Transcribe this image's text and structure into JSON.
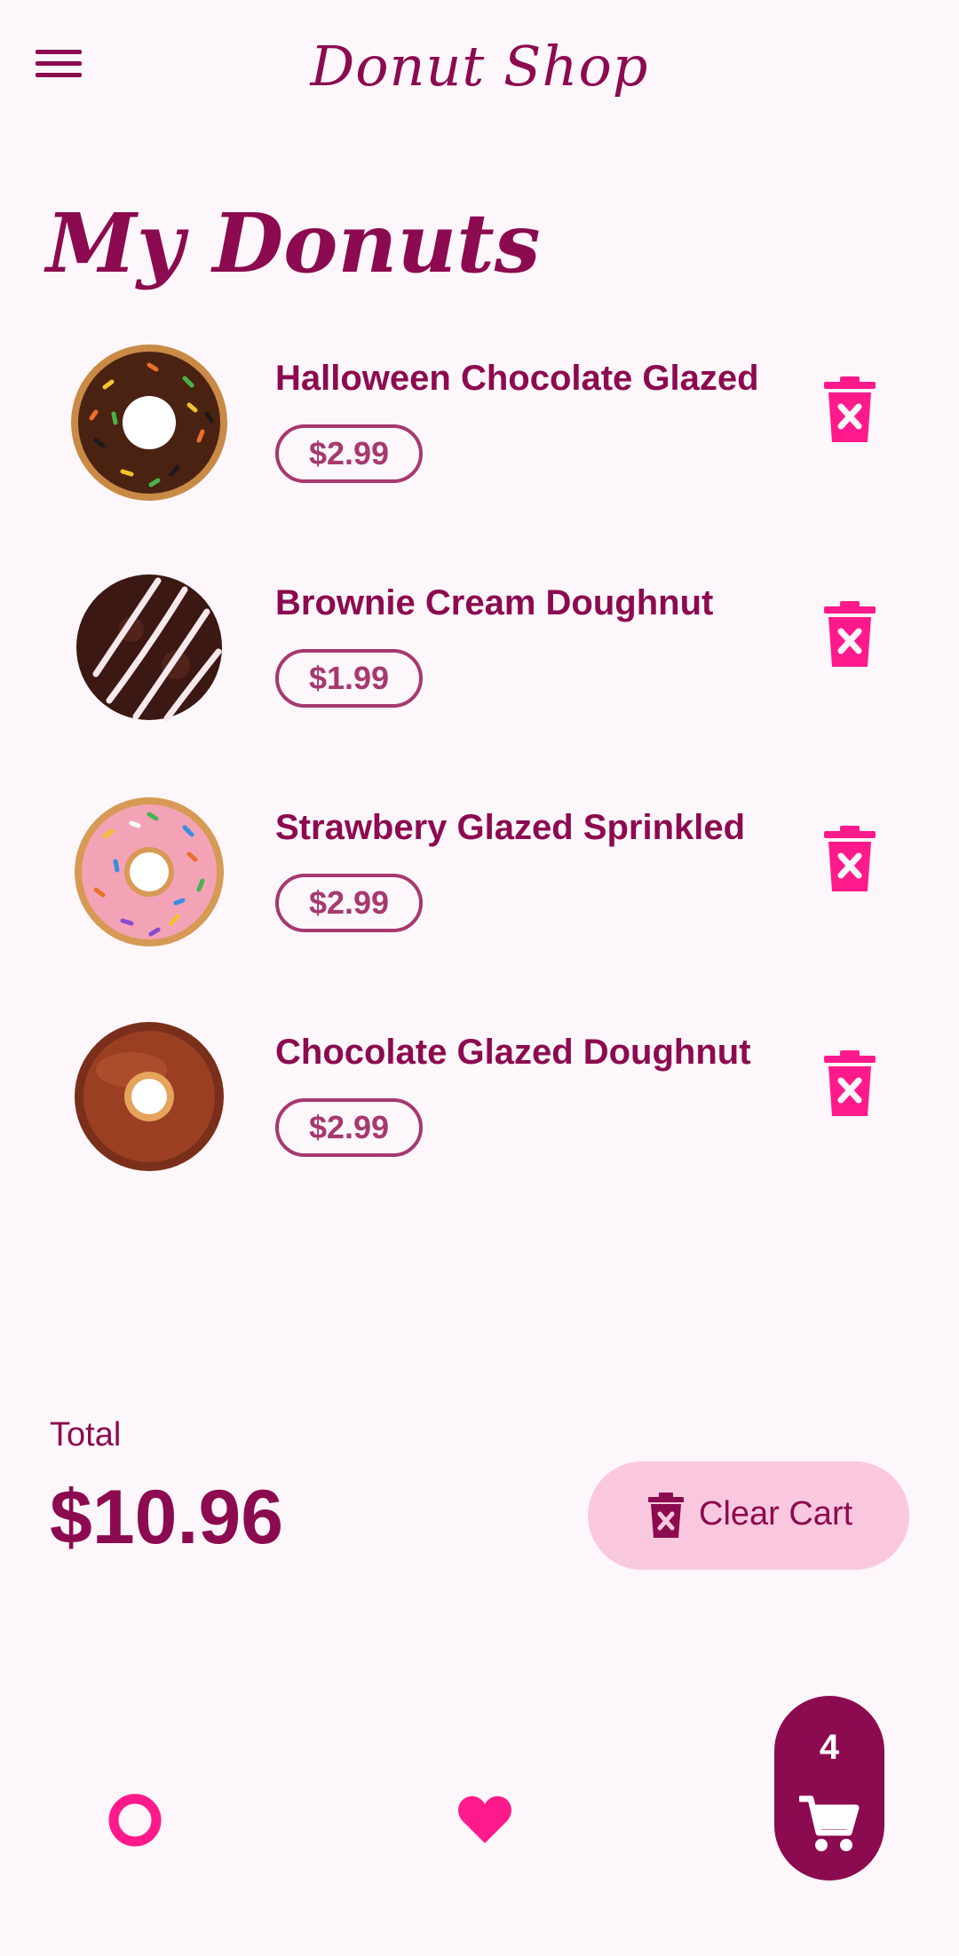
{
  "app": {
    "title": "Donut Shop"
  },
  "page": {
    "title": "My Donuts"
  },
  "cart": {
    "items": [
      {
        "name": "Halloween Chocolate Glazed",
        "price": "$2.99"
      },
      {
        "name": "Brownie Cream Doughnut",
        "price": "$1.99"
      },
      {
        "name": "Strawbery Glazed Sprinkled",
        "price": "$2.99"
      },
      {
        "name": "Chocolate Glazed Doughnut",
        "price": "$2.99"
      }
    ],
    "total_label": "Total",
    "total_value": "$10.96",
    "clear_label": "Clear Cart",
    "count": "4"
  },
  "icons": {
    "menu": "menu-icon",
    "delete": "delete-icon",
    "home": "ring-icon",
    "favorites": "heart-icon",
    "cart": "shopping-cart-icon"
  },
  "colors": {
    "primary": "#8c0a4f",
    "accent": "#ff1a8c",
    "chip_border": "#a6396f",
    "clear_button": "#f9c8df",
    "background": "#fdf7fb"
  }
}
